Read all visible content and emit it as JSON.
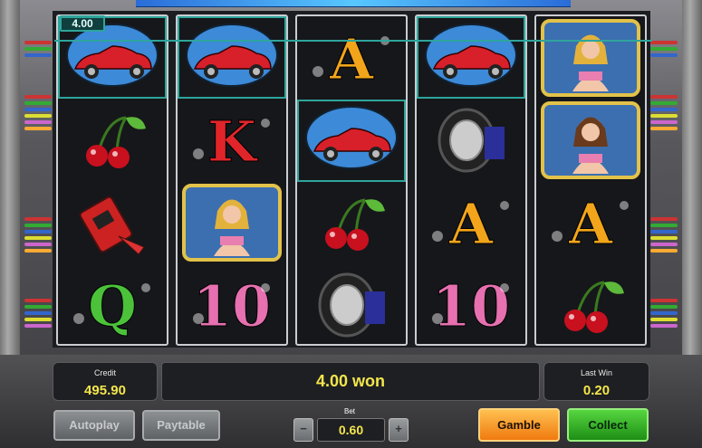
{
  "win_badge": "4.00",
  "reels": [
    [
      "car",
      "cherries",
      "oil-can",
      "Q"
    ],
    [
      "car",
      "K",
      "girl-blonde",
      "10"
    ],
    [
      "A",
      "car",
      "cherries",
      "tire"
    ],
    [
      "car",
      "tire",
      "A",
      "10"
    ],
    [
      "girl-blonde",
      "girl-brunette",
      "A",
      "cherries"
    ]
  ],
  "credit": {
    "label": "Credit",
    "value": "495.90"
  },
  "won": "4.00 won",
  "last_win": {
    "label": "Last Win",
    "value": "0.20"
  },
  "bet": {
    "label": "Bet",
    "value": "0.60",
    "minus": "−",
    "plus": "+"
  },
  "buttons": {
    "autoplay": "Autoplay",
    "paytable": "Paytable",
    "gamble": "Gamble",
    "collect": "Collect"
  },
  "colors": {
    "win_highlight": "#2ea59c",
    "value_text": "#f3e64c",
    "gamble": "#f07a10",
    "collect": "#1e8e15"
  }
}
